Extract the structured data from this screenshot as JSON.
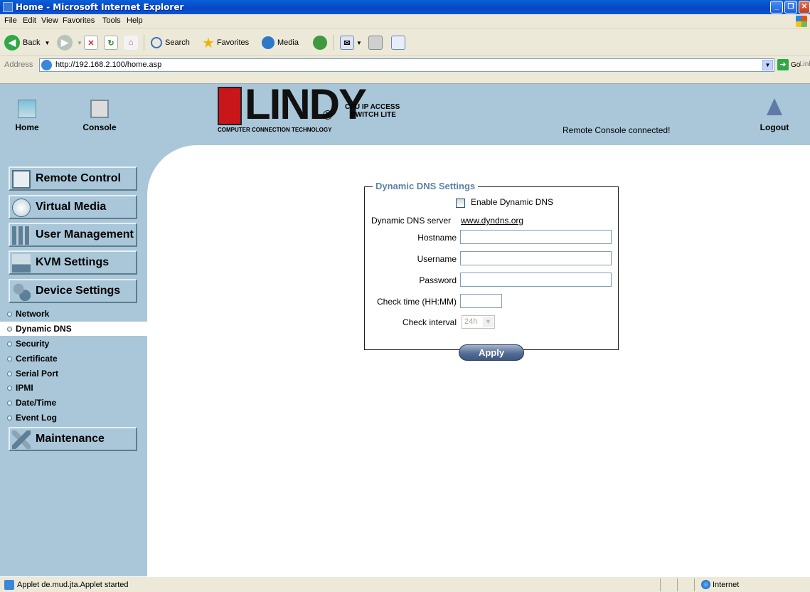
{
  "window": {
    "title": "Home - Microsoft Internet Explorer"
  },
  "menu": [
    "File",
    "Edit",
    "View",
    "Favorites",
    "Tools",
    "Help"
  ],
  "toolbar": {
    "back": "Back",
    "search": "Search",
    "favorites": "Favorites",
    "media": "Media"
  },
  "address": {
    "label": "Address",
    "url": "http://192.168.2.100/home.asp",
    "go": "Go",
    "links": "Links"
  },
  "header": {
    "home": "Home",
    "console": "Console",
    "logout": "Logout",
    "logo_text": "LINDY",
    "logo_reg": "®",
    "logo_tagline": "COMPUTER CONNECTION TECHNOLOGY",
    "product_line1": "CPU IP ACCESS",
    "product_line2": "SWITCH LITE",
    "status": "Remote Console connected!"
  },
  "sidebar": {
    "main": [
      {
        "label": "Remote Control",
        "icon": "monitor-icon"
      },
      {
        "label": "Virtual Media",
        "icon": "disc-icon"
      },
      {
        "label": "User Management",
        "icon": "users-icon"
      },
      {
        "label": "KVM Settings",
        "icon": "keyboard-icon"
      },
      {
        "label": "Device Settings",
        "icon": "gears-icon"
      }
    ],
    "sub": [
      "Network",
      "Dynamic DNS",
      "Security",
      "Certificate",
      "Serial Port",
      "IPMI",
      "Date/Time",
      "Event Log"
    ],
    "active_sub": "Dynamic DNS",
    "maintenance": {
      "label": "Maintenance",
      "icon": "tools-icon"
    }
  },
  "form": {
    "legend": "Dynamic DNS Settings",
    "enable_label": "Enable Dynamic DNS",
    "server_label": "Dynamic DNS server",
    "server_value": "www.dyndns.org",
    "hostname_label": "Hostname",
    "username_label": "Username",
    "password_label": "Password",
    "checktime_label": "Check time (HH:MM)",
    "interval_label": "Check interval",
    "interval_value": "24h",
    "apply": "Apply"
  },
  "status": {
    "text": "Applet de.mud.jta.Applet started",
    "zone": "Internet"
  },
  "colors": {
    "page_band": "#a9c7d8",
    "legend": "#5f82a6",
    "logo_red": "#c9161b"
  }
}
